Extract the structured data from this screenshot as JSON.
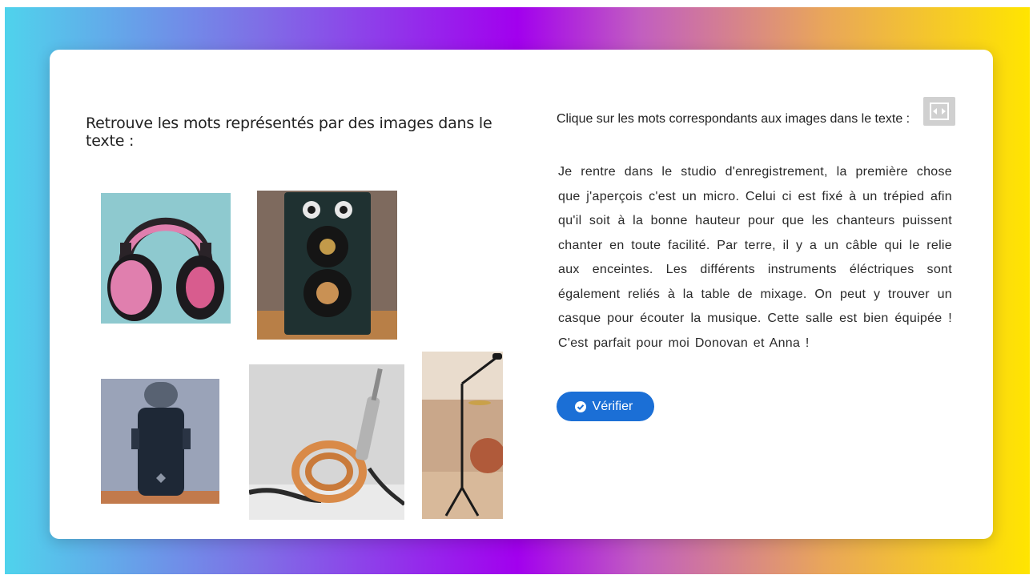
{
  "left_panel": {
    "instruction": "Retrouve les mots représentés par des images dans le texte :",
    "images": [
      {
        "name": "headphones-image"
      },
      {
        "name": "speaker-image"
      },
      {
        "name": "microphone-image"
      },
      {
        "name": "cable-image"
      },
      {
        "name": "mic-stand-image"
      }
    ]
  },
  "right_panel": {
    "instruction": "Clique sur les mots correspondants aux images dans le texte :",
    "passage": "Je rentre dans le studio d'enregistrement, la première chose que j'aperçois c'est un micro. Celui ci est fixé à un trépied afin qu'il soit à la bonne hauteur pour que les chanteurs puissent chanter en toute facilité. Par terre, il y a un câble qui le relie aux enceintes. Les différents instruments éléctriques sont également reliés à la table de mixage. On peut y trouver un casque pour écouter la musique. Cette salle est bien équipée ! C'est parfait pour moi Donovan et Anna !",
    "verify_label": "Vérifier"
  },
  "icons": {
    "fullscreen": "fullscreen-icon",
    "verify": "check-circle-icon"
  },
  "colors": {
    "accent": "#1b6fd6",
    "gradient": [
      "#4fd3ec",
      "#a200ee",
      "#ffe500"
    ]
  }
}
